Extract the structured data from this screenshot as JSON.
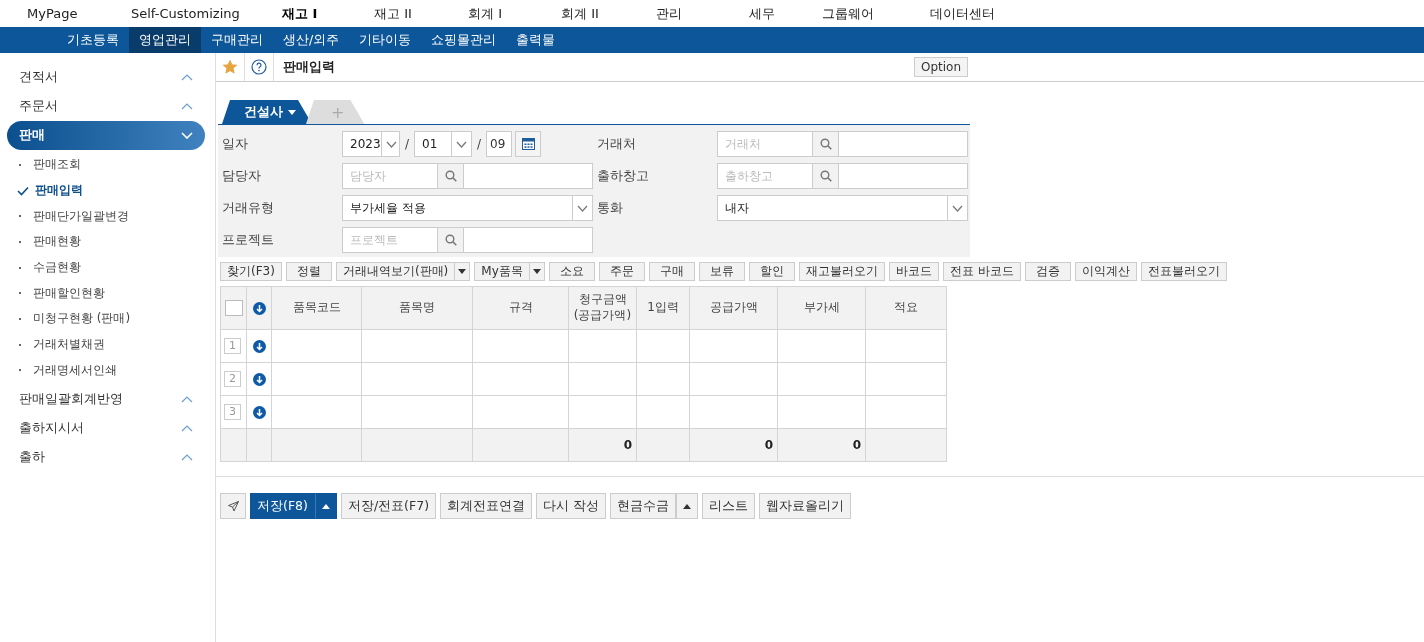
{
  "top_menu": [
    {
      "label": "MyPage",
      "selected": false
    },
    {
      "label": "Self-Customizing",
      "selected": false
    },
    {
      "label": "재고 I",
      "selected": true
    },
    {
      "label": "재고 II",
      "selected": false
    },
    {
      "label": "회계 I",
      "selected": false
    },
    {
      "label": "회계 II",
      "selected": false
    },
    {
      "label": "관리",
      "selected": false
    },
    {
      "label": "세무",
      "selected": false
    },
    {
      "label": "그룹웨어",
      "selected": false
    },
    {
      "label": "데이터센터",
      "selected": false
    }
  ],
  "sub_menu": [
    {
      "label": "기초등록",
      "selected": false
    },
    {
      "label": "영업관리",
      "selected": true
    },
    {
      "label": "구매관리",
      "selected": false
    },
    {
      "label": "생산/외주",
      "selected": false
    },
    {
      "label": "기타이동",
      "selected": false
    },
    {
      "label": "쇼핑몰관리",
      "selected": false
    },
    {
      "label": "출력물",
      "selected": false
    }
  ],
  "sidebar": {
    "items": [
      {
        "label": "견적서",
        "expanded": false,
        "selected": false
      },
      {
        "label": "주문서",
        "expanded": false,
        "selected": false
      },
      {
        "label": "판매",
        "expanded": true,
        "selected": true,
        "children": [
          {
            "label": "판매조회",
            "selected": false
          },
          {
            "label": "판매입력",
            "selected": true
          },
          {
            "label": "판매단가일괄변경",
            "selected": false
          },
          {
            "label": "판매현황",
            "selected": false
          },
          {
            "label": "수금현황",
            "selected": false
          },
          {
            "label": "판매할인현황",
            "selected": false
          },
          {
            "label": "미청구현황 (판매)",
            "selected": false
          },
          {
            "label": "거래처별채권",
            "selected": false
          },
          {
            "label": "거래명세서인쇄",
            "selected": false
          }
        ]
      },
      {
        "label": "판매일괄회계반영",
        "expanded": false,
        "selected": false
      },
      {
        "label": "출하지시서",
        "expanded": false,
        "selected": false
      },
      {
        "label": "출하",
        "expanded": false,
        "selected": false
      }
    ]
  },
  "header": {
    "favorite": true,
    "title": "판매입력",
    "option_button": "Option"
  },
  "tabs": [
    {
      "label": "건설사",
      "selected": true
    },
    {
      "label": "+",
      "selected": false
    }
  ],
  "form": {
    "fields": [
      {
        "kind": "date",
        "label": "일자",
        "year": "2023",
        "month": "01",
        "day": "09",
        "separators": [
          "/",
          "/"
        ]
      },
      {
        "kind": "search",
        "label": "거래처",
        "placeholder": "거래처"
      },
      {
        "kind": "search",
        "label": "담당자",
        "placeholder": "담당자"
      },
      {
        "kind": "search",
        "label": "출하창고",
        "placeholder": "출하창고"
      },
      {
        "kind": "select",
        "label": "거래유형",
        "value": "부가세율 적용"
      },
      {
        "kind": "select",
        "label": "통화",
        "value": "내자"
      },
      {
        "kind": "search",
        "label": "프로젝트",
        "placeholder": "프로젝트"
      }
    ]
  },
  "toolbar": [
    {
      "label": "찾기(F3)",
      "dropdown": false
    },
    {
      "label": "정렬",
      "dropdown": false
    },
    {
      "label": "거래내역보기(판매)",
      "dropdown": true
    },
    {
      "label": "My품목",
      "dropdown": true
    },
    {
      "label": "소요",
      "dropdown": false
    },
    {
      "label": "주문",
      "dropdown": false
    },
    {
      "label": "구매",
      "dropdown": false
    },
    {
      "label": "보류",
      "dropdown": false
    },
    {
      "label": "할인",
      "dropdown": false
    },
    {
      "label": "재고불러오기",
      "dropdown": false
    },
    {
      "label": "바코드",
      "dropdown": false
    },
    {
      "label": "전표 바코드",
      "dropdown": false
    },
    {
      "label": "검증",
      "dropdown": false
    },
    {
      "label": "이익계산",
      "dropdown": false
    },
    {
      "label": "전표불러오기",
      "dropdown": false
    }
  ],
  "grid": {
    "select_all": {
      "checked": false
    },
    "columns": [
      {
        "label": "품목코드"
      },
      {
        "label": "품목명"
      },
      {
        "label": "규격"
      },
      {
        "label": "청구금액 (공급가액)",
        "total": "0"
      },
      {
        "label": "1입력"
      },
      {
        "label": "공급가액",
        "total": "0"
      },
      {
        "label": "부가세",
        "total": "0"
      },
      {
        "label": "적요"
      }
    ],
    "rows": [
      {
        "number": "1"
      },
      {
        "number": "2"
      },
      {
        "number": "3"
      }
    ]
  },
  "footer_buttons": [
    {
      "label": "저장(F8)",
      "kind": "primary",
      "dropdown": true
    },
    {
      "label": "저장/전표(F7)",
      "kind": "default",
      "dropdown": false
    },
    {
      "label": "회계전표연결",
      "kind": "default",
      "dropdown": false
    },
    {
      "label": "다시 작성",
      "kind": "default",
      "dropdown": false
    },
    {
      "label": "현금수금",
      "kind": "default",
      "dropdown": true
    },
    {
      "label": "리스트",
      "kind": "default",
      "dropdown": false
    },
    {
      "label": "웹자료올리기",
      "kind": "default",
      "dropdown": false
    }
  ]
}
